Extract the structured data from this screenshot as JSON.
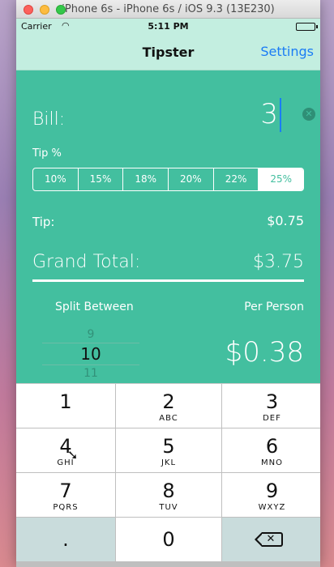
{
  "window": {
    "title": "iPhone 6s - iPhone 6s / iOS 9.3 (13E230)"
  },
  "status_bar": {
    "carrier": "Carrier",
    "time": "5:11 PM"
  },
  "nav": {
    "title": "Tipster",
    "settings": "Settings"
  },
  "bill": {
    "label": "Bill:",
    "value": "3"
  },
  "tip_percent": {
    "label": "Tip %",
    "options": [
      "10%",
      "15%",
      "18%",
      "20%",
      "22%",
      "25%"
    ],
    "selected": "25%"
  },
  "tip": {
    "label": "Tip:",
    "value": "$0.75"
  },
  "grand_total": {
    "label": "Grand Total:",
    "value": "$3.75"
  },
  "split": {
    "label": "Split Between",
    "per_person_label": "Per Person",
    "picker": {
      "prev": "9",
      "selected": "10",
      "next": "11"
    },
    "per_person_value": "$0.38"
  },
  "keypad": {
    "keys": [
      {
        "num": "1",
        "letters": ""
      },
      {
        "num": "2",
        "letters": "ABC"
      },
      {
        "num": "3",
        "letters": "DEF"
      },
      {
        "num": "4",
        "letters": "GHI"
      },
      {
        "num": "5",
        "letters": "JKL"
      },
      {
        "num": "6",
        "letters": "MNO"
      },
      {
        "num": "7",
        "letters": "PQRS"
      },
      {
        "num": "8",
        "letters": "TUV"
      },
      {
        "num": "9",
        "letters": "WXYZ"
      }
    ],
    "dot": ".",
    "zero": "0"
  },
  "colors": {
    "accent": "#43bf9f",
    "nav_bg": "#c3eee0",
    "link": "#1a7cf5"
  }
}
